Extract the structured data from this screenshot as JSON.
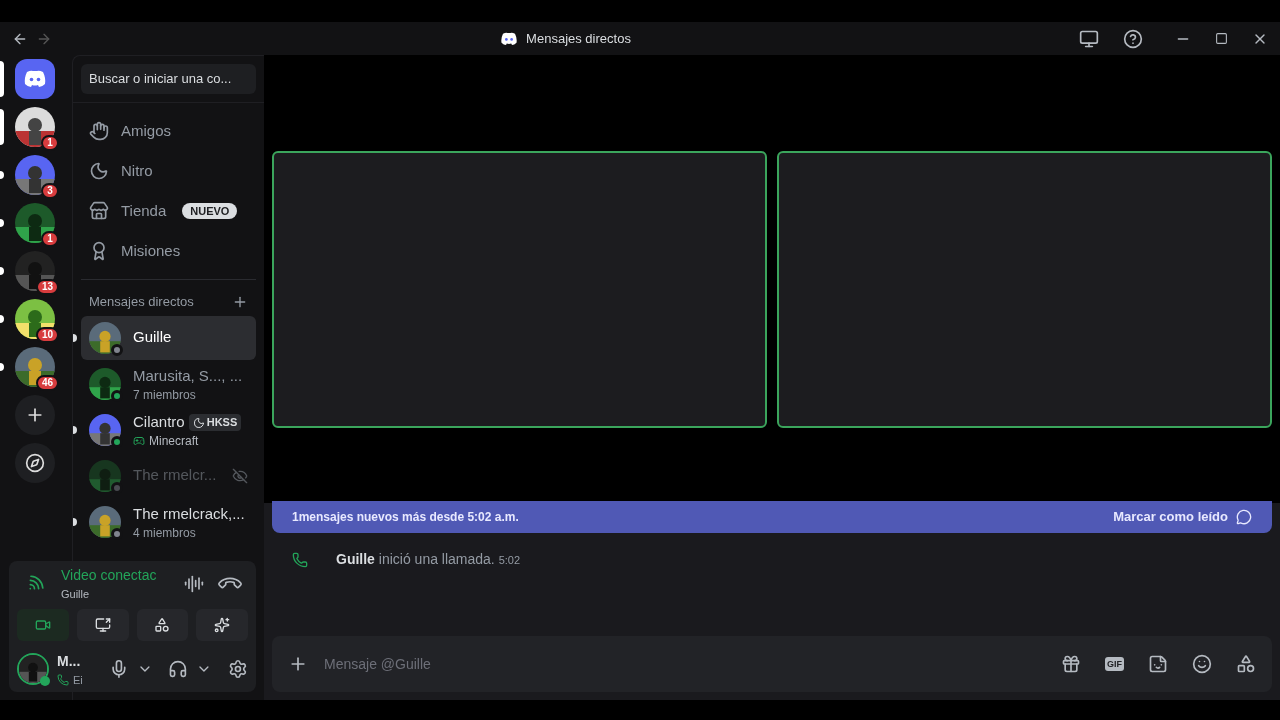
{
  "window": {
    "title": "Mensajes directos"
  },
  "search": {
    "placeholder": "Buscar o iniciar una co..."
  },
  "servers": [
    {
      "kind": "home",
      "selected": true
    },
    {
      "kind": "server",
      "selected": true,
      "badge": "1"
    },
    {
      "kind": "server",
      "selected": false,
      "unread": true,
      "badge": "3"
    },
    {
      "kind": "server",
      "selected": false,
      "unread": true,
      "badge": "1"
    },
    {
      "kind": "server",
      "selected": false,
      "unread": true,
      "badge": "13"
    },
    {
      "kind": "server",
      "selected": false,
      "unread": true,
      "badge": "10"
    },
    {
      "kind": "server",
      "selected": false,
      "unread": true,
      "badge": "46"
    },
    {
      "kind": "add"
    },
    {
      "kind": "discover"
    }
  ],
  "nav": [
    {
      "kind": "friends",
      "label": "Amigos",
      "selected": false
    },
    {
      "kind": "nitro",
      "label": "Nitro",
      "selected": false
    },
    {
      "kind": "shop",
      "label": "Tienda",
      "selected": false,
      "badge": "NUEVO"
    },
    {
      "kind": "quests",
      "label": "Misiones",
      "selected": false
    }
  ],
  "dm_header": {
    "title": "Mensajes directos"
  },
  "dms": [
    {
      "name": "Guille",
      "selected": true,
      "unread": true,
      "online": false,
      "muted": false,
      "kind": "user"
    },
    {
      "name": "Marusita, S..., ...",
      "subtitle": "7 miembros",
      "selected": false,
      "unread": false,
      "online": true,
      "muted": false,
      "kind": "group"
    },
    {
      "name": "Cilantro",
      "tag": "HKSS",
      "activity": "Minecraft",
      "selected": false,
      "unread": true,
      "online": true,
      "muted": false,
      "kind": "user"
    },
    {
      "name": "The rmelcr...",
      "selected": false,
      "unread": false,
      "online": false,
      "muted": true,
      "kind": "user"
    },
    {
      "name": "The rmelcrack,...",
      "subtitle": "4 miembros",
      "selected": false,
      "unread": true,
      "online": false,
      "muted": false,
      "kind": "group"
    }
  ],
  "voice": {
    "status": "Video conectac",
    "channel": "Guille",
    "controls": [
      {
        "kind": "video",
        "on": true
      },
      {
        "kind": "screen",
        "on": false
      },
      {
        "kind": "activities",
        "on": false
      },
      {
        "kind": "soundboard",
        "on": false
      }
    ]
  },
  "user": {
    "name": "M...",
    "status": "Ei"
  },
  "call": {
    "tiles": [
      {
        "speaking": true
      },
      {
        "speaking": true
      }
    ]
  },
  "banner": {
    "text": "1mensajes nuevos más desde 5:02 a.m.",
    "action": "Marcar como leído"
  },
  "messages": [
    {
      "author": "Guille",
      "text": "inició una llamada.",
      "time": "5:02"
    }
  ],
  "composer": {
    "placeholder": "Mensaje @Guille",
    "gif_label": "GIF"
  }
}
